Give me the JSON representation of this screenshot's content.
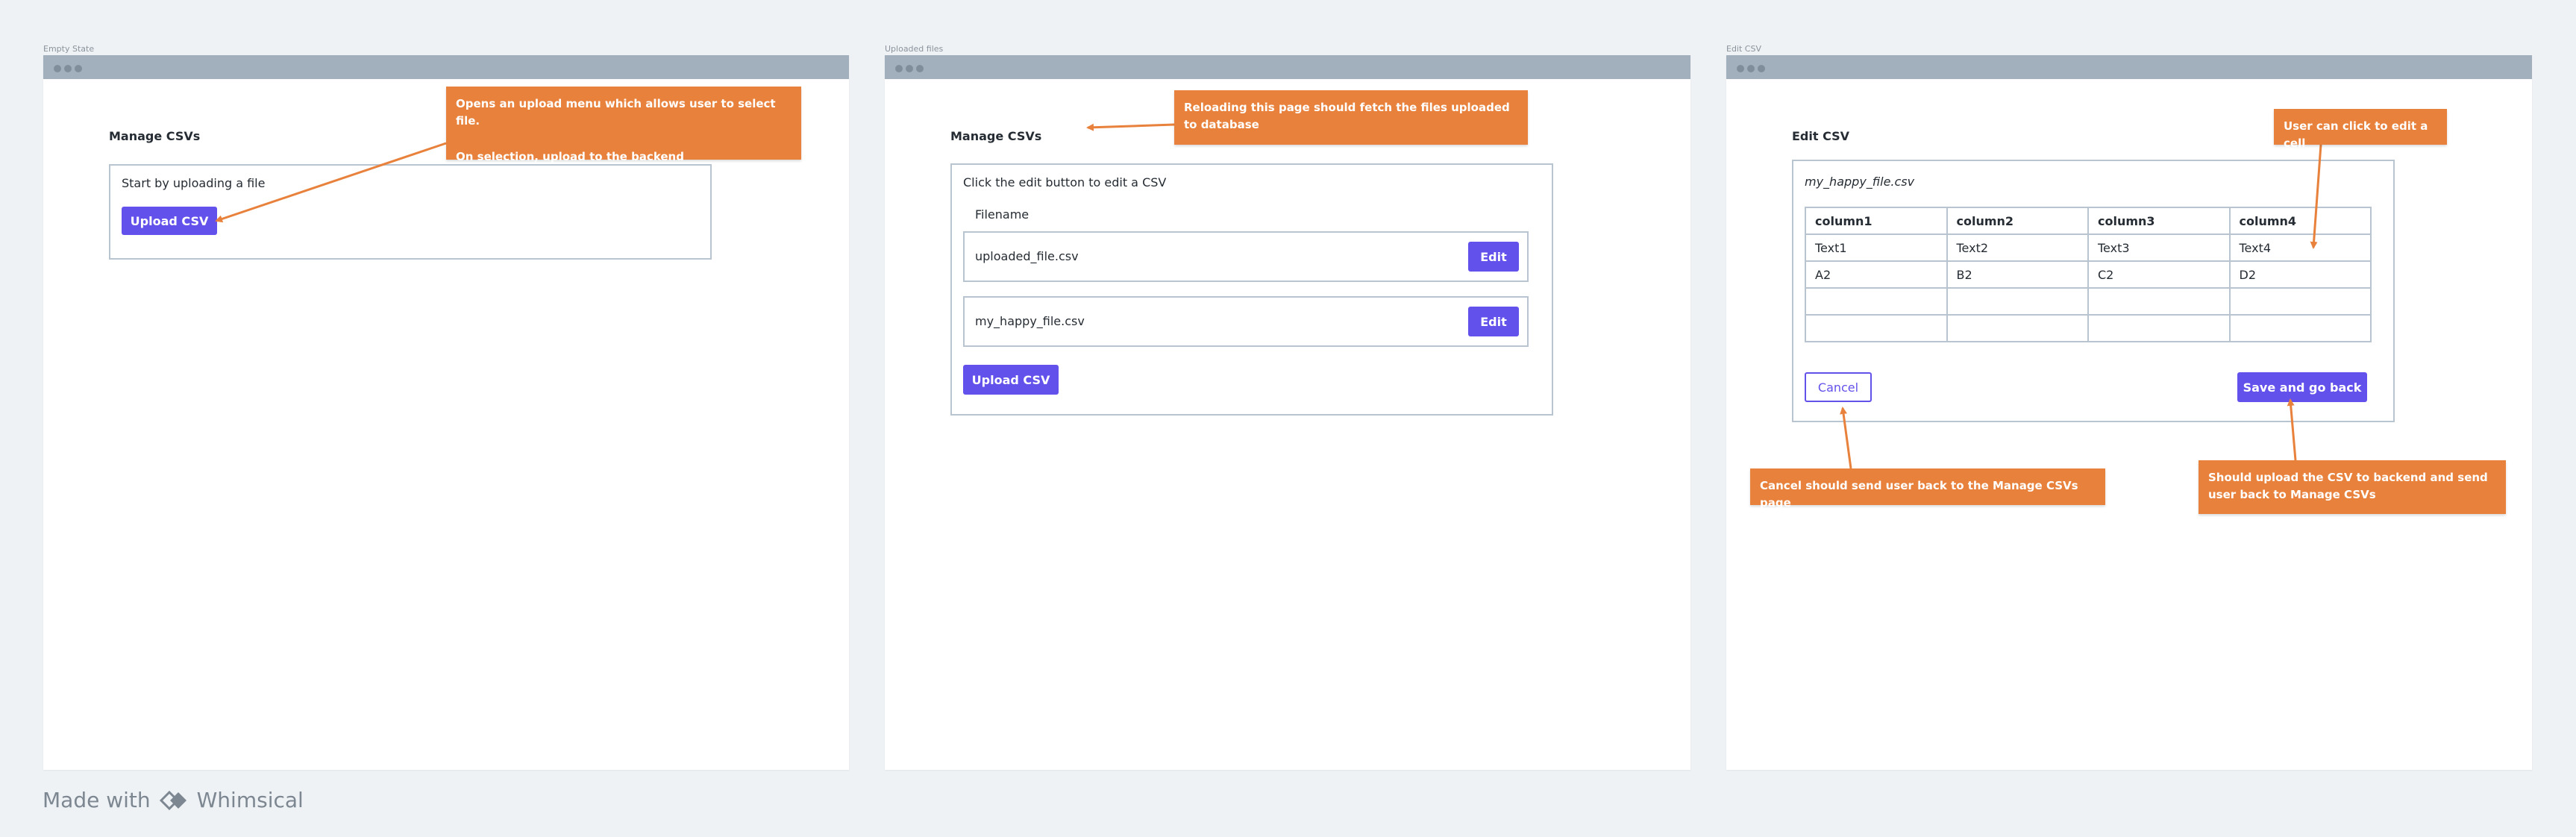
{
  "frames": {
    "empty": {
      "title": "Empty State"
    },
    "uploaded": {
      "title": "Uploaded files"
    },
    "edit": {
      "title": "Edit CSV"
    }
  },
  "empty_state": {
    "heading": "Manage CSVs",
    "prompt": "Start by uploading a file",
    "upload_button": "Upload CSV"
  },
  "uploaded_files": {
    "heading": "Manage CSVs",
    "instruction": "Click the edit button to edit a CSV",
    "column_header": "Filename",
    "files": [
      {
        "name": "uploaded_file.csv",
        "edit_label": "Edit"
      },
      {
        "name": "my_happy_file.csv",
        "edit_label": "Edit"
      }
    ],
    "upload_button": "Upload CSV"
  },
  "edit_csv": {
    "heading": "Edit CSV",
    "filename": "my_happy_file.csv",
    "table": {
      "headers": [
        "column1",
        "column2",
        "column3",
        "column4"
      ],
      "rows": [
        [
          "Text1",
          "Text2",
          "Text3",
          "Text4"
        ],
        [
          "A2",
          "B2",
          "C2",
          "D2"
        ],
        [
          "",
          "",
          "",
          ""
        ],
        [
          "",
          "",
          "",
          ""
        ]
      ]
    },
    "cancel_button": "Cancel",
    "save_button": "Save and go back"
  },
  "notes": {
    "upload_menu_line1": "Opens an upload menu which allows user to select file.",
    "upload_menu_line2": "On selection, upload to the backend",
    "reload": "Reloading this page should fetch the files uploaded to database",
    "edit_cell": "User can click to edit a cell",
    "cancel": "Cancel should send user back to the Manage CSVs page",
    "save": "Should upload the CSV to backend and send user back to Manage CSVs"
  },
  "footer": {
    "made_with": "Made with",
    "brand": "Whimsical"
  },
  "colors": {
    "accent": "#6351eb",
    "note": "#e8813b",
    "window_bar": "#a2b0bd",
    "background": "#eff2f5"
  }
}
